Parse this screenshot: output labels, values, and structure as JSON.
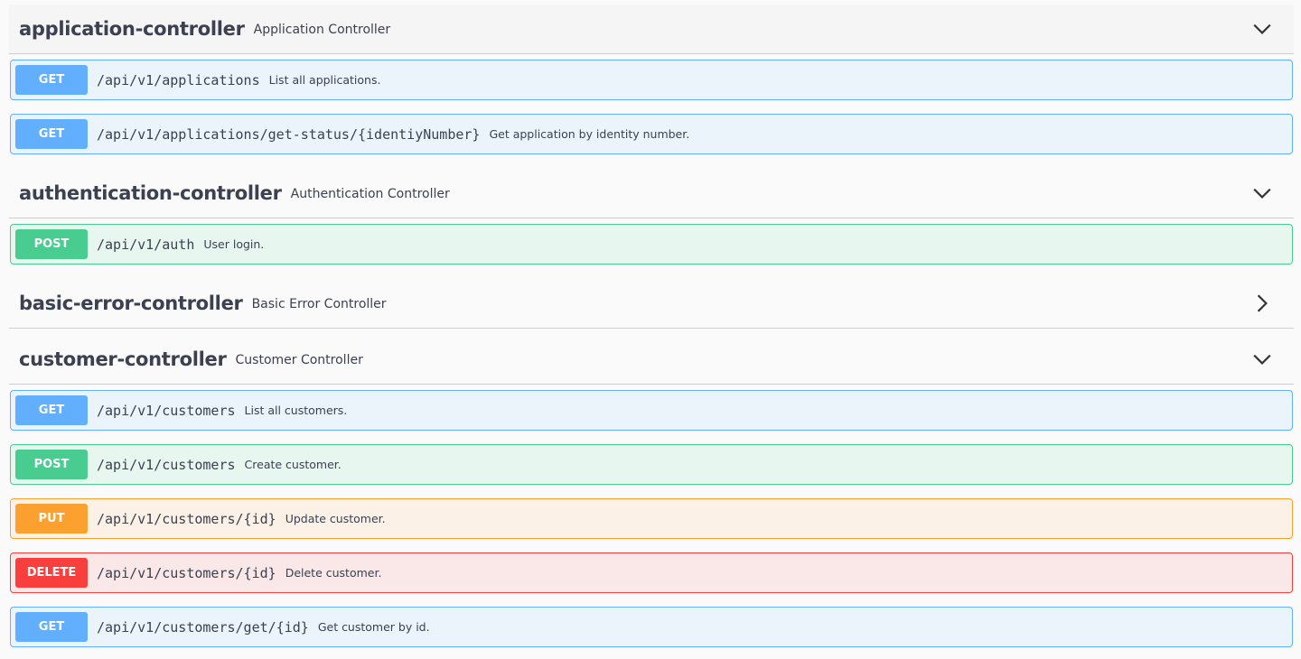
{
  "colors": {
    "get": "#61affe",
    "post": "#49cc90",
    "put": "#fca130",
    "delete": "#f93e3e",
    "text": "#3b4151"
  },
  "tags": [
    {
      "name": "application-controller",
      "description": "Application Controller",
      "arrow_icon": "chevron-down-icon",
      "expanded": true,
      "operations": [
        {
          "method": "GET",
          "path": "/api/v1/applications",
          "summary": "List all applications."
        },
        {
          "method": "GET",
          "path": "/api/v1/applications/get-status/{identiyNumber}",
          "summary": "Get application by identity number."
        }
      ]
    },
    {
      "name": "authentication-controller",
      "description": "Authentication Controller",
      "arrow_icon": "chevron-down-icon",
      "expanded": true,
      "operations": [
        {
          "method": "POST",
          "path": "/api/v1/auth",
          "summary": "User login."
        }
      ]
    },
    {
      "name": "basic-error-controller",
      "description": "Basic Error Controller",
      "arrow_icon": "chevron-right-icon",
      "expanded": false,
      "operations": []
    },
    {
      "name": "customer-controller",
      "description": "Customer Controller",
      "arrow_icon": "chevron-down-icon",
      "expanded": true,
      "operations": [
        {
          "method": "GET",
          "path": "/api/v1/customers",
          "summary": "List all customers."
        },
        {
          "method": "POST",
          "path": "/api/v1/customers",
          "summary": "Create customer."
        },
        {
          "method": "PUT",
          "path": "/api/v1/customers/{id}",
          "summary": "Update customer."
        },
        {
          "method": "DELETE",
          "path": "/api/v1/customers/{id}",
          "summary": "Delete customer."
        },
        {
          "method": "GET",
          "path": "/api/v1/customers/get/{id}",
          "summary": "Get customer by id."
        }
      ]
    }
  ]
}
